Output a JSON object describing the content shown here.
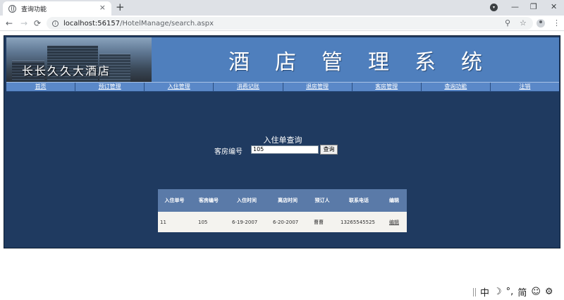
{
  "browser": {
    "tab_title": "查询功能",
    "tab_close": "×",
    "new_tab": "+",
    "url_host": "localhost:56157",
    "url_path": "/HotelManage/search.aspx",
    "back": "←",
    "forward": "→",
    "reload": "⟳",
    "info": "i",
    "minimize": "—",
    "restore": "❐",
    "close": "✕",
    "zoom_icon": "⚲",
    "star_icon": "☆",
    "menu_icon": "⋮"
  },
  "banner": {
    "photo_caption": "长长久久大酒店",
    "title": "酒店管理系统"
  },
  "menu": {
    "items": [
      "首页",
      "预订管理",
      "入住管理",
      "消费记账",
      "退房管理",
      "客房管理",
      "查询功能",
      "注销"
    ]
  },
  "search_form": {
    "title": "入住单查询",
    "room_label": "客房编号",
    "room_value": "105",
    "query_button": "查询"
  },
  "results": {
    "columns": [
      "入住单号",
      "客房编号",
      "入住时间",
      "离店时间",
      "预订人",
      "联系电话",
      "编辑"
    ],
    "rows": [
      [
        "11",
        "105",
        "6-19-2007",
        "6-20-2007",
        "曹曹",
        "13265545525",
        "编辑"
      ]
    ]
  },
  "ime": {
    "items": [
      "中",
      "☽",
      "°,",
      "简",
      "☺",
      "⚙"
    ]
  },
  "colors": {
    "page_bg": "#1f3a60",
    "banner_bg": "#4f7fbd",
    "menu_bg": "#5a88c8",
    "table_header": "#5a7aa8",
    "table_row": "#f4f3ef"
  }
}
